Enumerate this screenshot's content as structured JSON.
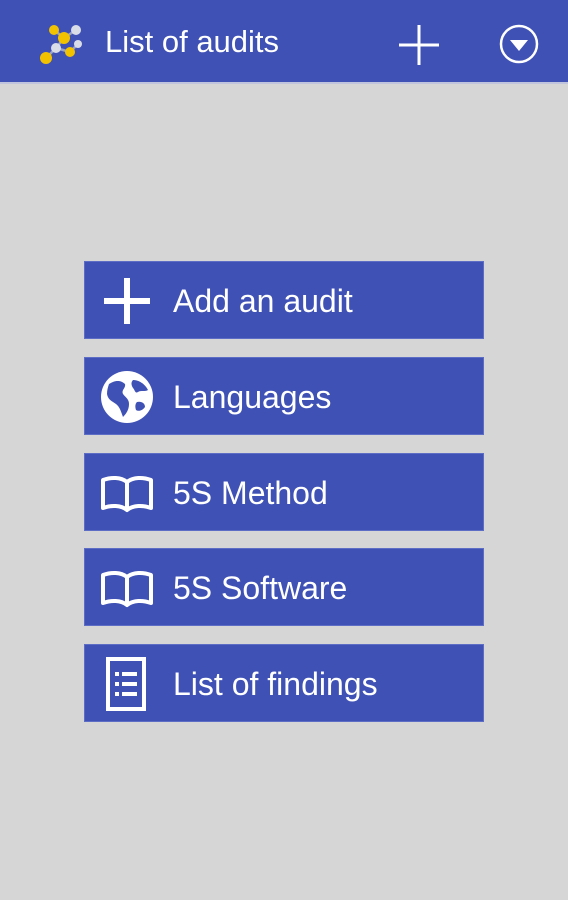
{
  "colors": {
    "background": "#d6d6d6",
    "primary": "#3f51b5",
    "text": "#ffffff"
  },
  "app_bar": {
    "title": "List of audits",
    "logo_icon": "molecule-logo-icon",
    "actions": [
      {
        "icon": "plus-icon",
        "label": "add"
      },
      {
        "icon": "chevron-down-circle-icon",
        "label": "menu"
      }
    ]
  },
  "menu": {
    "items": [
      {
        "label": "Add an audit",
        "icon": "plus-icon"
      },
      {
        "label": "Languages",
        "icon": "globe-icon"
      },
      {
        "label": "5S Method",
        "icon": "book-icon"
      },
      {
        "label": "5S Software",
        "icon": "book-icon"
      },
      {
        "label": "List of findings",
        "icon": "list-document-icon"
      }
    ]
  }
}
